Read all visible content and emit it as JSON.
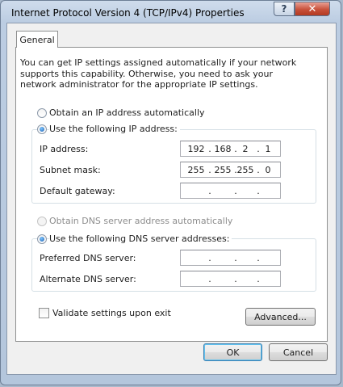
{
  "window": {
    "title": "Internet Protocol Version 4 (TCP/IPv4) Properties",
    "help_label": "?",
    "close_label": "✕"
  },
  "tabs": [
    {
      "label": "General"
    }
  ],
  "description": "You can get IP settings assigned automatically if your network supports this capability. Otherwise, you need to ask your network administrator for the appropriate IP settings.",
  "ip_mode": {
    "auto_label": "Obtain an IP address automatically",
    "manual_label": "Use the following IP address:",
    "selected": "manual"
  },
  "ip_fields": {
    "ip_address": {
      "label": "IP address:",
      "octets": [
        "192",
        "168",
        "2",
        "1"
      ]
    },
    "subnet_mask": {
      "label": "Subnet mask:",
      "octets": [
        "255",
        "255",
        "255",
        "0"
      ]
    },
    "default_gateway": {
      "label": "Default gateway:",
      "octets": [
        "",
        "",
        "",
        ""
      ]
    }
  },
  "dns_mode": {
    "auto_label": "Obtain DNS server address automatically",
    "manual_label": "Use the following DNS server addresses:",
    "selected": "manual"
  },
  "dns_fields": {
    "preferred": {
      "label": "Preferred DNS server:",
      "octets": [
        "",
        "",
        "",
        ""
      ]
    },
    "alternate": {
      "label": "Alternate DNS server:",
      "octets": [
        "",
        "",
        "",
        ""
      ]
    }
  },
  "validate": {
    "label": "Validate settings upon exit",
    "checked": false
  },
  "buttons": {
    "advanced": "Advanced...",
    "ok": "OK",
    "cancel": "Cancel"
  }
}
